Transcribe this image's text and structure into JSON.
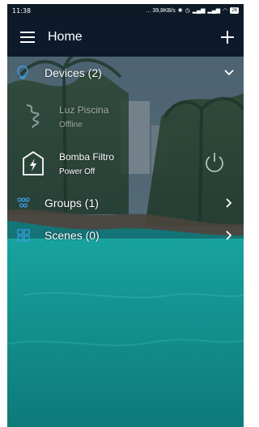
{
  "status_bar": {
    "time": "11:38",
    "speed": "... 39,8KB/s",
    "battery": "26"
  },
  "app_bar": {
    "title": "Home",
    "menu_icon": "hamburger-menu-icon",
    "add_icon": "plus-icon"
  },
  "sections": {
    "devices": {
      "label": "Devices (2)",
      "icon": "lightbulb-icon",
      "chevron": "chevron-down-icon"
    },
    "groups": {
      "label": "Groups (1)",
      "icon": "group-nodes-icon",
      "chevron": "chevron-right-icon"
    },
    "scenes": {
      "label": "Scenes (0)",
      "icon": "scenes-grid-icon",
      "chevron": "chevron-right-icon"
    }
  },
  "devices": [
    {
      "name": "Luz Piscina",
      "status": "Offline",
      "icon": "light-strip-icon"
    },
    {
      "name": "Bomba Filtro",
      "status": "Power Off",
      "icon": "smart-plug-icon",
      "action_icon": "power-icon"
    }
  ],
  "colors": {
    "app_bar": "#0c1a2b",
    "accent": "#3aa0e8",
    "text": "#ffffff",
    "water": "#1a8f8c"
  }
}
